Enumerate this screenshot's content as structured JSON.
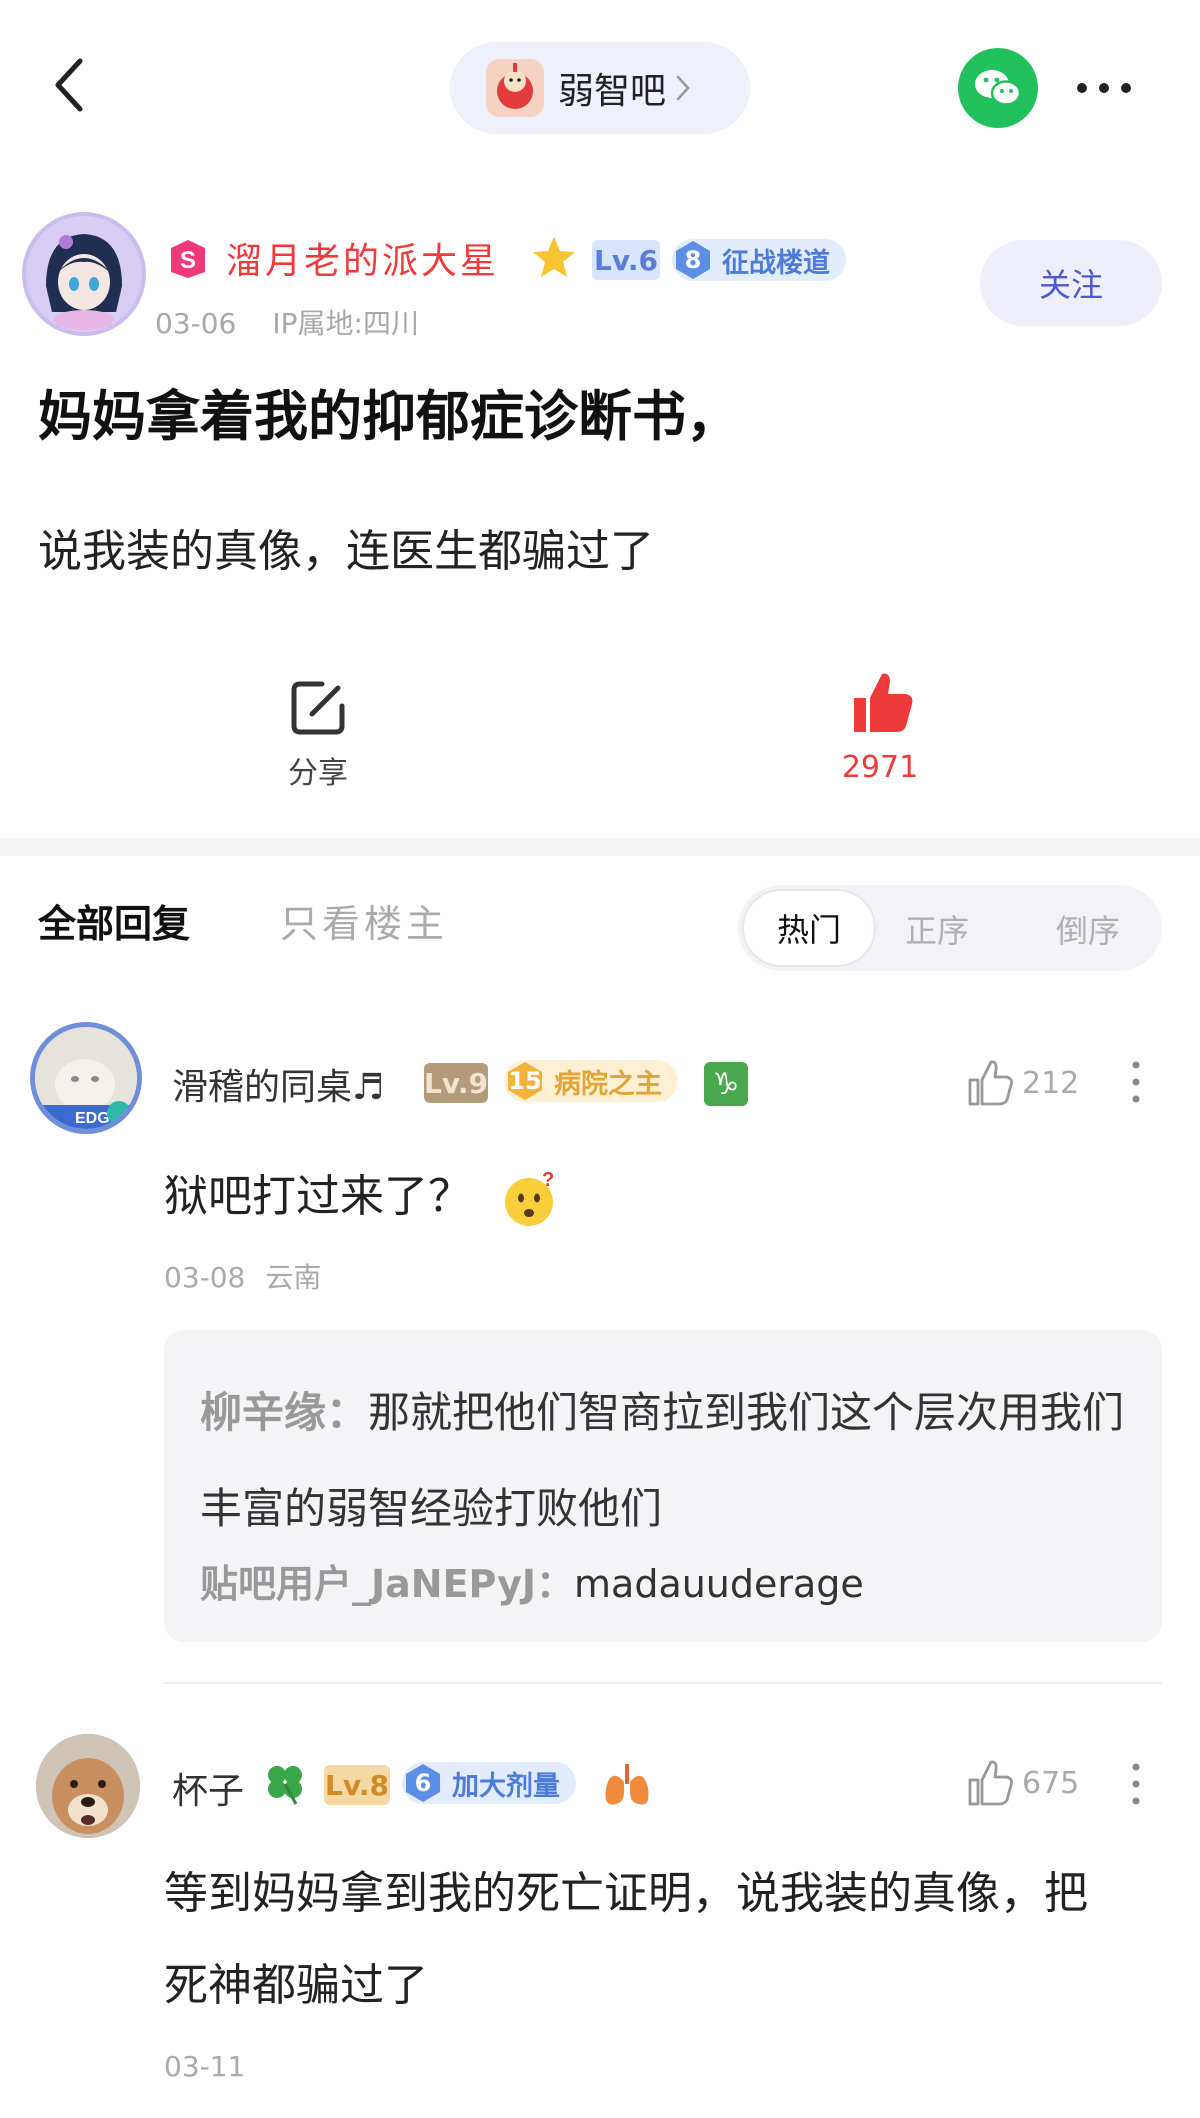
{
  "forum": {
    "name": "弱智吧"
  },
  "post": {
    "author": "溜月老的派大星",
    "level": "Lv.6",
    "title_badge": {
      "num": "8",
      "label": "征战楼道"
    },
    "date": "03-06",
    "ip": "IP属地:四川",
    "follow_label": "关注",
    "title": "妈妈拿着我的抑郁症诊断书，",
    "body": "说我装的真像，连医生都骗过了",
    "share_label": "分享",
    "like_count": "2971"
  },
  "tabs": {
    "all": "全部回复",
    "op_only": "只看楼主"
  },
  "sort": {
    "hot": "热门",
    "asc": "正序",
    "desc": "倒序"
  },
  "comments": [
    {
      "name": "滑稽的同桌♬",
      "level": "Lv.9",
      "title_badge": {
        "num": "15",
        "label": "病院之主"
      },
      "zodiac": "♑",
      "like_count": "212",
      "text": "狱吧打过来了？",
      "date": "03-08",
      "location": "云南",
      "replies": [
        {
          "author": "柳辛缘：",
          "text": "那就把他们智商拉到我们这个层次用我们丰富的弱智经验打败他们"
        },
        {
          "author": "贴吧用户_JaNEPyJ：",
          "text": "madauuderage"
        }
      ]
    },
    {
      "name": "杯子",
      "level": "Lv.8",
      "title_badge": {
        "num": "6",
        "label": "加大剂量"
      },
      "like_count": "675",
      "text": "等到妈妈拿到我的死亡证明，说我装的真像，把死神都骗过了",
      "date": "03-11"
    }
  ],
  "colors": {
    "accent_red": "#ee3a3a",
    "wechat_green": "#22c15e",
    "follow_blue": "#4d5acb"
  }
}
